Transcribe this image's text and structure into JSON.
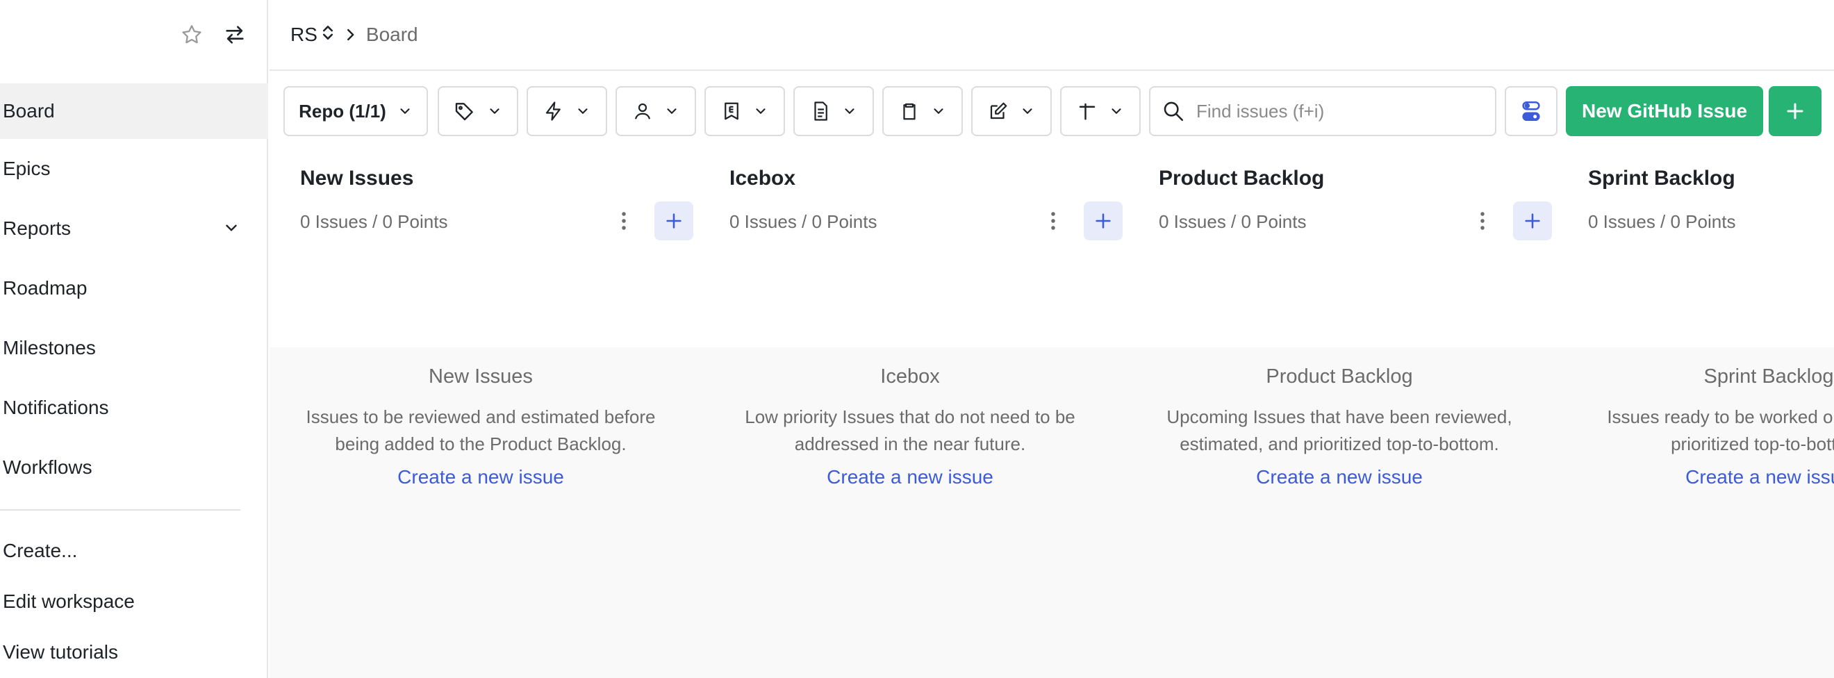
{
  "sidebar": {
    "items": [
      {
        "label": "Board",
        "active": true
      },
      {
        "label": "Epics"
      },
      {
        "label": "Reports",
        "expandable": true
      },
      {
        "label": "Roadmap"
      },
      {
        "label": "Milestones"
      },
      {
        "label": "Notifications"
      },
      {
        "label": "Workflows"
      }
    ],
    "actions": [
      "Create...",
      "Edit workspace",
      "View tutorials"
    ],
    "icons": [
      "star-icon",
      "switch-arrows-icon"
    ]
  },
  "header": {
    "workspace": "RS",
    "page": "Board"
  },
  "toolbar": {
    "repo_label": "Repo (1/1)",
    "filters": [
      "tag-icon",
      "lightning-icon",
      "user-icon",
      "epic-icon",
      "document-icon",
      "clipboard-icon",
      "edit-icon",
      "milestone-icon"
    ],
    "search_placeholder": "Find issues (f+i)",
    "new_issue_label": "New GitHub Issue"
  },
  "columns": [
    {
      "title": "New Issues",
      "count": "0 Issues / 0 Points",
      "empty_title": "New Issues",
      "empty_desc": "Issues to be reviewed and estimated before being added to the Product Backlog.",
      "link": "Create a new issue"
    },
    {
      "title": "Icebox",
      "count": "0 Issues / 0 Points",
      "empty_title": "Icebox",
      "empty_desc": "Low priority Issues that do not need to be addressed in the near future.",
      "link": "Create a new issue"
    },
    {
      "title": "Product Backlog",
      "count": "0 Issues / 0 Points",
      "empty_title": "Product Backlog",
      "empty_desc": "Upcoming Issues that have been reviewed, estimated, and prioritized top-to-bottom.",
      "link": "Create a new issue"
    },
    {
      "title": "Sprint Backlog",
      "count": "0 Issues / 0 Points",
      "empty_title": "Sprint Backlog",
      "empty_desc": "Issues ready to be worked on this sprint, prioritized top-to-bottom.",
      "link": "Create a new issue"
    }
  ],
  "colors": {
    "primary_green": "#27b374",
    "link_blue": "#3b5bdb",
    "add_bg": "#e8ebfa"
  }
}
